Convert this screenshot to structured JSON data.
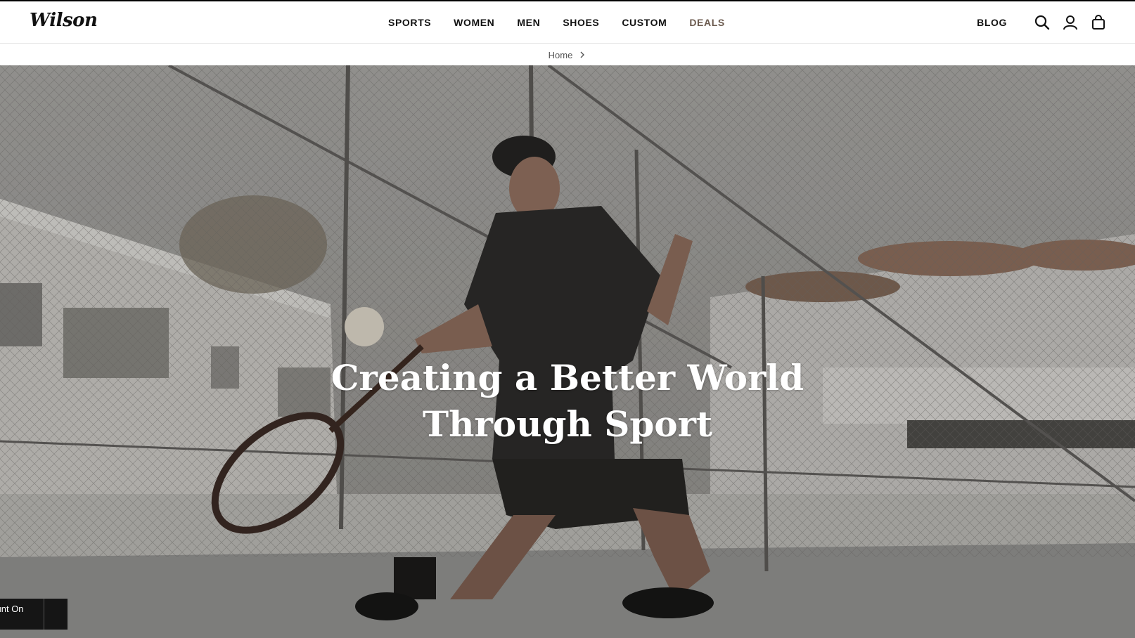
{
  "header": {
    "logo": "Wilson",
    "nav": [
      "SPORTS",
      "WOMEN",
      "MEN",
      "SHOES",
      "CUSTOM",
      "DEALS"
    ],
    "blog": "BLOG",
    "icons": [
      "search-icon",
      "account-icon",
      "cart-icon"
    ]
  },
  "breadcrumb": {
    "home": "Home"
  },
  "hero": {
    "title_line1": "Creating a Better World",
    "title_line2": "Through Sport"
  },
  "promo": {
    "text": "Discount On Order!"
  },
  "colors": {
    "accent": "#6b5a4e",
    "text": "#111111",
    "promo_bg": "#151515"
  }
}
